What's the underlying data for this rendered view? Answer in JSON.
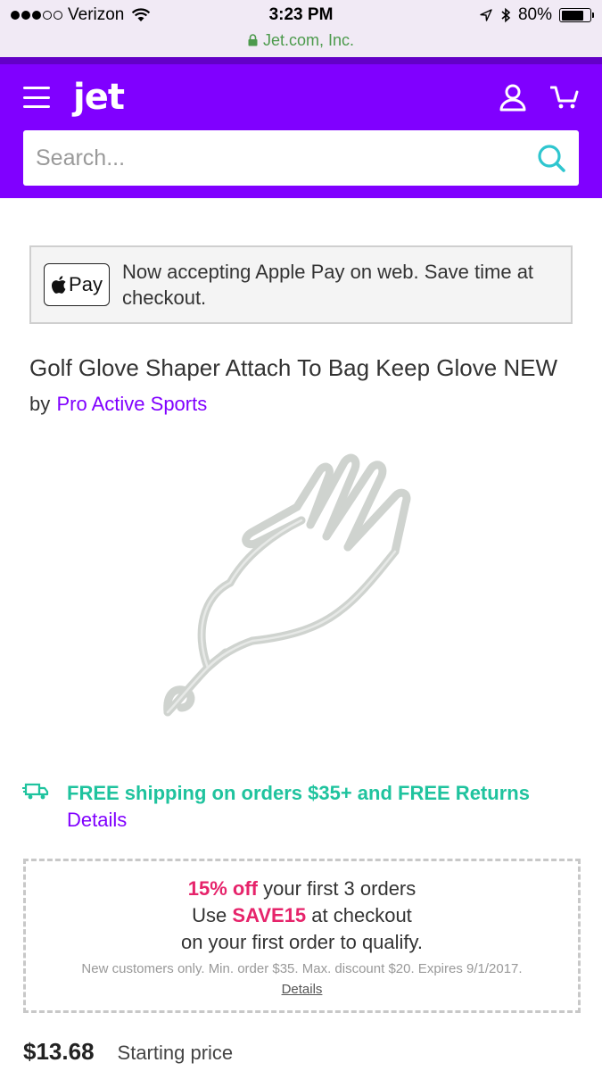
{
  "status_bar": {
    "carrier": "Verizon",
    "time": "3:23 PM",
    "battery": "80%",
    "battery_level": 0.8,
    "url": "Jet.com, Inc."
  },
  "header": {
    "logo": "jet",
    "search_placeholder": "Search..."
  },
  "apple_pay_banner": {
    "badge": "Pay",
    "text": "Now accepting Apple Pay on web. Save time at checkout."
  },
  "product": {
    "title": "Golf Glove Shaper Attach To Bag Keep Glove NEW",
    "by": "by",
    "brand": "Pro Active Sports"
  },
  "shipping": {
    "text": "FREE shipping on orders $35+ and FREE Returns",
    "details": "Details"
  },
  "promo": {
    "discount": "15% off",
    "line1_rest": " your first 3 orders",
    "use": "Use ",
    "code": "SAVE15",
    "line2_rest": " at checkout",
    "line3": "on your first order to qualify.",
    "fine_print": "New customers only. Min. order $35. Max. discount $20. Expires 9/1/2017.",
    "details": "Details"
  },
  "price": {
    "value": "$13.68",
    "label": "Starting price"
  },
  "colors": {
    "brand_purple": "#8000ff",
    "free_green": "#1fc39e",
    "promo_pink": "#e6246b"
  }
}
